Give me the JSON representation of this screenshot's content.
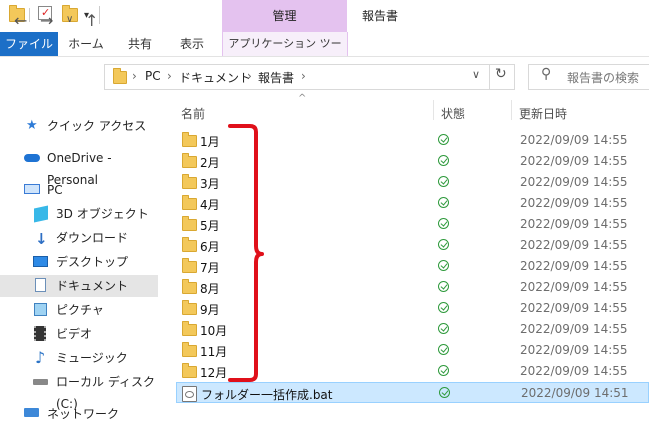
{
  "window": {
    "title": "報告書",
    "context_tab": "管理"
  },
  "ribbon": {
    "tabs": [
      "ファイル",
      "ホーム",
      "共有",
      "表示",
      "アプリケーション ツール"
    ]
  },
  "address": {
    "crumbs": [
      "PC",
      "ドキュメント",
      "報告書"
    ],
    "search_placeholder": "報告書の検索"
  },
  "sidebar": {
    "items": [
      {
        "label": "クイック アクセス",
        "icon": "star-icon"
      },
      {
        "label": "OneDrive - Personal",
        "icon": "cloud-icon"
      },
      {
        "label": "PC",
        "icon": "computer-icon"
      },
      {
        "label": "3D オブジェクト",
        "icon": "cube-icon"
      },
      {
        "label": "ダウンロード",
        "icon": "download-icon"
      },
      {
        "label": "デスクトップ",
        "icon": "desktop-icon"
      },
      {
        "label": "ドキュメント",
        "icon": "document-icon"
      },
      {
        "label": "ピクチャ",
        "icon": "picture-icon"
      },
      {
        "label": "ビデオ",
        "icon": "video-icon"
      },
      {
        "label": "ミュージック",
        "icon": "music-icon"
      },
      {
        "label": "ローカル ディスク (C:)",
        "icon": "disk-icon"
      },
      {
        "label": "ネットワーク",
        "icon": "network-icon"
      }
    ]
  },
  "list": {
    "headers": {
      "name": "名前",
      "status": "状態",
      "date": "更新日時"
    },
    "rows": [
      {
        "name": "1月",
        "date": "2022/09/09 14:55"
      },
      {
        "name": "2月",
        "date": "2022/09/09 14:55"
      },
      {
        "name": "3月",
        "date": "2022/09/09 14:55"
      },
      {
        "name": "4月",
        "date": "2022/09/09 14:55"
      },
      {
        "name": "5月",
        "date": "2022/09/09 14:55"
      },
      {
        "name": "6月",
        "date": "2022/09/09 14:55"
      },
      {
        "name": "7月",
        "date": "2022/09/09 14:55"
      },
      {
        "name": "8月",
        "date": "2022/09/09 14:55"
      },
      {
        "name": "9月",
        "date": "2022/09/09 14:55"
      },
      {
        "name": "10月",
        "date": "2022/09/09 14:55"
      },
      {
        "name": "11月",
        "date": "2022/09/09 14:55"
      },
      {
        "name": "12月",
        "date": "2022/09/09 14:55"
      },
      {
        "name": "フォルダー一括作成.bat",
        "date": "2022/09/09 14:51"
      }
    ]
  },
  "colors": {
    "accent": "#1c6fc7",
    "context_tab": "#e4c2ef",
    "bracket": "#e0101a",
    "selection": "#cce8ff"
  }
}
